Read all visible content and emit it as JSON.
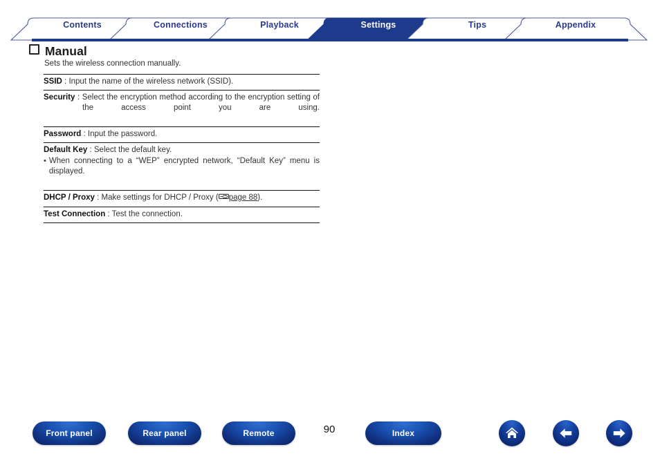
{
  "tabs": [
    {
      "label": "Contents",
      "active": false
    },
    {
      "label": "Connections",
      "active": false
    },
    {
      "label": "Playback",
      "active": false
    },
    {
      "label": "Settings",
      "active": true
    },
    {
      "label": "Tips",
      "active": false
    },
    {
      "label": "Appendix",
      "active": false
    }
  ],
  "section": {
    "bullet_icon": "hollow-square-icon",
    "title": "Manual",
    "subtitle": "Sets the wireless connection manually."
  },
  "spec_rows": [
    {
      "term": "SSID",
      "separator": " : ",
      "description": "Input the name of the wireless network (SSID)."
    },
    {
      "term": "Security",
      "separator": " : ",
      "description": "Select the encryption method according to the encryption setting of the access point you are using."
    },
    {
      "term": "Password",
      "separator": " : ",
      "description": "Input the password."
    },
    {
      "term": "Default Key",
      "separator": " : ",
      "description": "Select the default key.",
      "note_bullet": "•",
      "note": "When connecting to a “WEP” encrypted network, “Default Key” menu is displayed."
    },
    {
      "term": "DHCP / Proxy",
      "separator": " : ",
      "description_before_link": "Make settings for DHCP / Proxy (",
      "link_glyph": "page-reference-icon",
      "link_text": "page 88",
      "description_after_link": ")."
    },
    {
      "term": "Test Connection",
      "separator": " : ",
      "description": "Test the connection."
    }
  ],
  "footer": {
    "buttons": [
      {
        "label": "Front panel"
      },
      {
        "label": "Rear panel"
      },
      {
        "label": "Remote"
      },
      {
        "label": "Index"
      }
    ],
    "page_number": "90",
    "nav_icons": [
      {
        "name": "home-icon"
      },
      {
        "name": "arrow-left-icon"
      },
      {
        "name": "arrow-right-icon"
      }
    ]
  },
  "colors": {
    "tab_active_fill": "#1e3a8c",
    "tab_text": "#2b3a8f",
    "tab_text_active": "#ffffff",
    "tab_border": "#4a55a0",
    "rule": "#111111",
    "button_blue": "#10307e"
  }
}
